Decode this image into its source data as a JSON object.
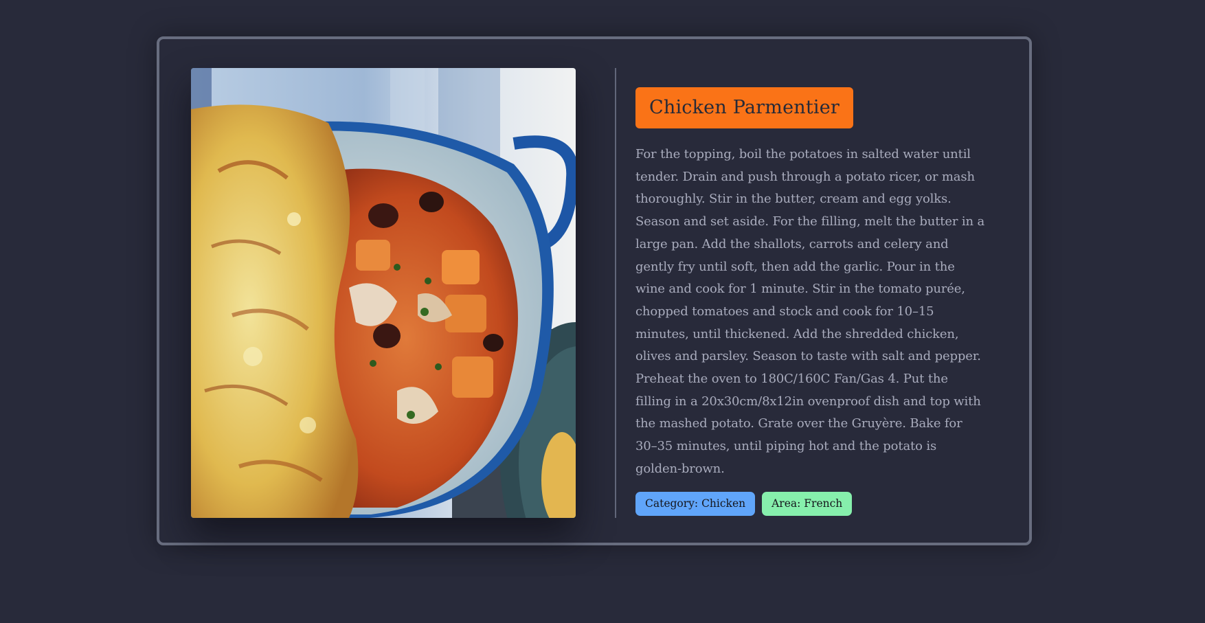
{
  "meal": {
    "title": "Chicken Parmentier",
    "image_alt": "Chicken Parmentier",
    "instructions": "For the topping, boil the potatoes in salted water until tender. Drain and push through a potato ricer, or mash thoroughly. Stir in the butter, cream and egg yolks. Season and set aside. For the filling, melt the butter in a large pan. Add the shallots, carrots and celery and gently fry until soft, then add the garlic. Pour in the wine and cook for 1 minute. Stir in the tomato purée, chopped tomatoes and stock and cook for 10–15 minutes, until thickened. Add the shredded chicken, olives and parsley. Season to taste with salt and pepper. Preheat the oven to 180C/160C Fan/Gas 4. Put the filling in a 20x30cm/8x12in ovenproof dish and top with the mashed potato. Grate over the Gruyère. Bake for 30–35 minutes, until piping hot and the potato is golden-brown.",
    "tags": {
      "category": "Category: Chicken",
      "area": "Area: French"
    }
  },
  "colors": {
    "background": "#282a3a",
    "card_border": "#686d7f",
    "title_badge": "#fa7317",
    "category_tag": "#60a5fa",
    "area_tag": "#86efac",
    "body_text": "#a9acbd"
  }
}
